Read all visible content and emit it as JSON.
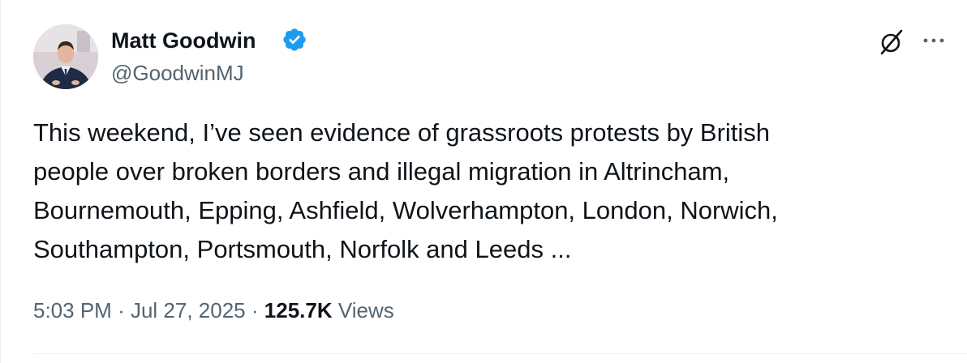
{
  "author": {
    "name": "Matt Goodwin",
    "handle": "@GoodwinMJ",
    "verified_color": "#1d9bf0"
  },
  "header_actions": {
    "grok_icon": "grok-icon",
    "more_icon": "more-icon"
  },
  "tweet": {
    "text": "This weekend, I’ve seen evidence of grassroots protests by British\npeople over broken borders and illegal migration in Altrincham,\nBournemouth, Epping, Ashfield, Wolverhampton, London, Norwich,\nSouthampton, Portsmouth, Norfolk and Leeds ..."
  },
  "meta": {
    "time": "5:03 PM",
    "separator": "·",
    "date": "Jul 27, 2025",
    "views_count": "125.7K",
    "views_label": "Views"
  }
}
